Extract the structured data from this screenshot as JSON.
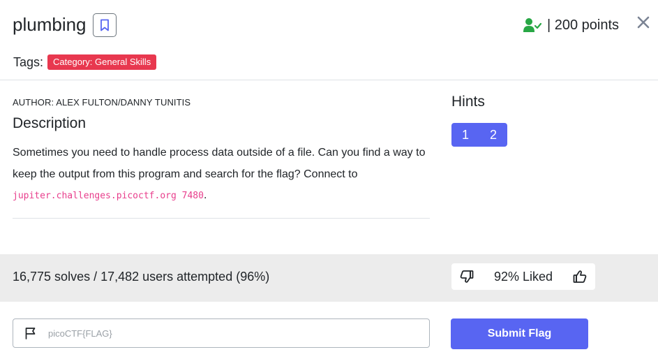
{
  "challenge": {
    "title": "plumbing",
    "points_label": "| 200 points",
    "tags_label": "Tags:",
    "tags": [
      "Category: General Skills"
    ]
  },
  "description": {
    "author": "AUTHOR: ALEX FULTON/DANNY TUNITIS",
    "heading": "Description",
    "text_before": "Sometimes you need to handle process data outside of a file. Can you find a way to keep the output from this program and search for the flag? Connect to ",
    "code": "jupiter.challenges.picoctf.org 7480",
    "text_after": "."
  },
  "hints": {
    "heading": "Hints",
    "buttons": [
      "1",
      "2"
    ]
  },
  "stats": {
    "solves_text": "16,775 solves / 17,482 users attempted (96%)",
    "liked_text": "92% Liked"
  },
  "submit": {
    "placeholder": "picoCTF{FLAG}",
    "button_label": "Submit Flag"
  },
  "colors": {
    "accent": "#5865f2",
    "tag": "#e8384f",
    "success_icon": "#28a745",
    "code": "#e83e8c"
  },
  "icons": {
    "bookmark": "bookmark-icon",
    "solved_user": "user-check-icon",
    "close": "close-icon",
    "dislike": "thumbs-down-icon",
    "like": "thumbs-up-icon",
    "flag": "flag-icon"
  }
}
